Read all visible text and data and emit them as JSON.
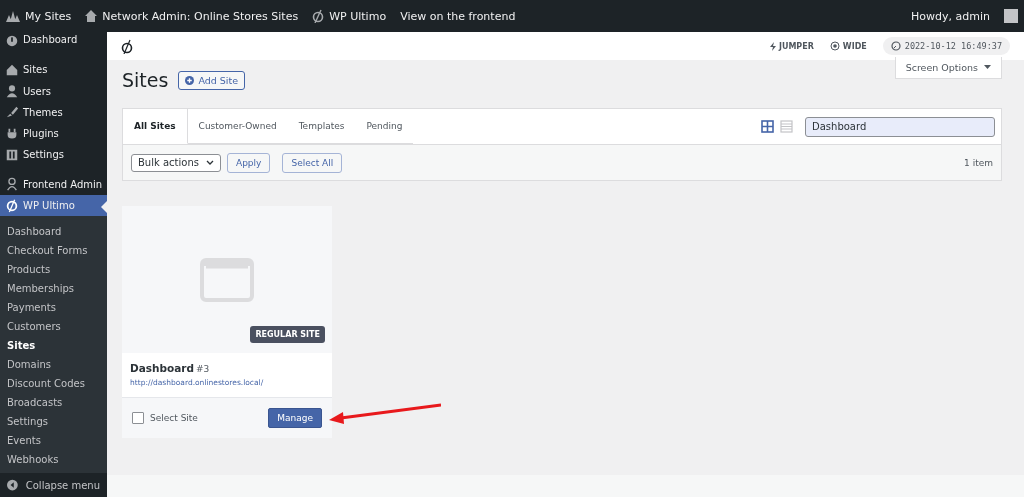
{
  "admin_bar": {
    "items": [
      {
        "kind": "sites",
        "label": "My Sites"
      },
      {
        "kind": "home",
        "label": "Network Admin: Online Stores Sites"
      },
      {
        "kind": "logo",
        "label": "WP Ultimo"
      },
      {
        "kind": "plain",
        "label": "View on the frontend"
      }
    ],
    "greeting": "Howdy, admin"
  },
  "sidebar": {
    "menu": [
      {
        "label": "Dashboard",
        "selected": false,
        "gap_after": true
      },
      {
        "label": "Sites",
        "selected": false,
        "gap_after": false
      },
      {
        "label": "Users",
        "selected": false,
        "gap_after": false
      },
      {
        "label": "Themes",
        "selected": false,
        "gap_after": false
      },
      {
        "label": "Plugins",
        "selected": false,
        "gap_after": false
      },
      {
        "label": "Settings",
        "selected": false,
        "gap_after": true
      },
      {
        "label": "Frontend Admin",
        "selected": false,
        "gap_after": false
      },
      {
        "label": "WP Ultimo",
        "selected": true,
        "gap_after": false
      }
    ],
    "submenu": [
      {
        "label": "Dashboard",
        "selected": false
      },
      {
        "label": "Checkout Forms",
        "selected": false
      },
      {
        "label": "Products",
        "selected": false
      },
      {
        "label": "Memberships",
        "selected": false
      },
      {
        "label": "Payments",
        "selected": false
      },
      {
        "label": "Customers",
        "selected": false
      },
      {
        "label": "Sites",
        "selected": true
      },
      {
        "label": "Domains",
        "selected": false
      },
      {
        "label": "Discount Codes",
        "selected": false
      },
      {
        "label": "Broadcasts",
        "selected": false
      },
      {
        "label": "Settings",
        "selected": false
      },
      {
        "label": "Events",
        "selected": false
      },
      {
        "label": "Webhooks",
        "selected": false
      }
    ],
    "collapse": "Collapse menu"
  },
  "header": {
    "jumper": "JUMPER",
    "wide": "WIDE",
    "clock": "2022-10-12 16:49:37"
  },
  "page": {
    "title": "Sites",
    "add_button": "Add Site",
    "screen_options": "Screen Options"
  },
  "tabs": [
    {
      "label": "All Sites",
      "selected": true
    },
    {
      "label": "Customer-Owned",
      "selected": false
    },
    {
      "label": "Templates",
      "selected": false
    },
    {
      "label": "Pending",
      "selected": false
    }
  ],
  "view_toggle": {
    "grid_selected": true
  },
  "search": {
    "value": "Dashboard"
  },
  "toolbar": {
    "bulk_actions": "Bulk actions",
    "apply": "Apply",
    "select_all": "Select All",
    "count": "1 item"
  },
  "sites": [
    {
      "badge": "REGULAR SITE",
      "name": "Dashboard",
      "id": "#3",
      "url": "http://dashboard.onlinestores.local/",
      "checkbox_label": "Select Site",
      "checked": false,
      "manage": "Manage"
    }
  ]
}
